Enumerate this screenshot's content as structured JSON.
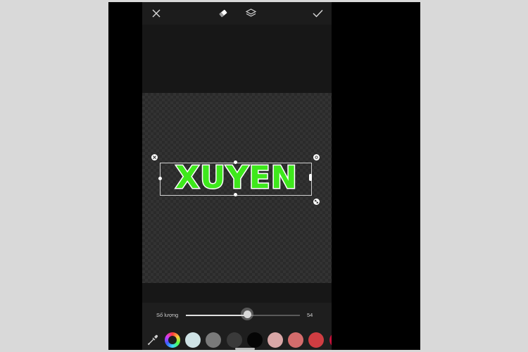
{
  "toolbar": {
    "close_icon": "close-icon",
    "eraser_icon": "eraser-icon",
    "layers_icon": "layers-icon",
    "confirm_icon": "check-icon"
  },
  "canvas": {
    "sticker_text": "XUYEN",
    "sticker_fill_color": "#3ee81c",
    "sticker_outline_color": "#ffffff"
  },
  "slider": {
    "label": "Số lượng",
    "value": "54",
    "fraction": 0.54
  },
  "palette": {
    "swatches": [
      {
        "name": "color-wheel",
        "color": "conic"
      },
      {
        "name": "light-cyan",
        "color": "#cfe3e6"
      },
      {
        "name": "gray",
        "color": "#7a7a7a"
      },
      {
        "name": "dark-gray",
        "color": "#3a3a3a"
      },
      {
        "name": "black",
        "color": "#050505"
      },
      {
        "name": "pale-pink",
        "color": "#d9a7a7"
      },
      {
        "name": "salmon",
        "color": "#d46c6c"
      },
      {
        "name": "red",
        "color": "#cf3d42"
      },
      {
        "name": "crimson",
        "color": "#c8103a"
      }
    ]
  }
}
